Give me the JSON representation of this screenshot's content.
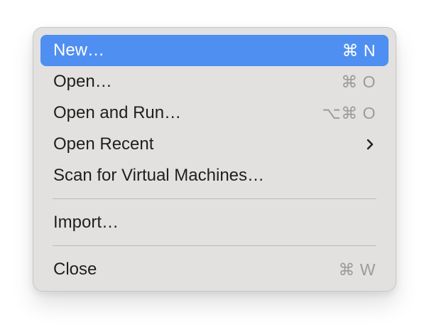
{
  "menu": {
    "items": [
      {
        "label": "New…",
        "shortcut": "⌘ N",
        "active": true
      },
      {
        "label": "Open…",
        "shortcut": "⌘ O",
        "active": false
      },
      {
        "label": "Open and Run…",
        "shortcut": "⌥⌘ O",
        "active": false
      },
      {
        "label": "Open Recent",
        "submenu_icon": "chevron-right-icon",
        "active": false
      },
      {
        "label": "Scan for Virtual Machines…",
        "shortcut": "",
        "active": false
      },
      {
        "label": "Import…",
        "shortcut": "",
        "active": false
      },
      {
        "label": "Close",
        "shortcut": "⌘ W",
        "active": false
      }
    ]
  },
  "colors": {
    "menu_background": "#e2e1df",
    "selection": "#4f8ff1",
    "text": "#1f1f1f",
    "shortcut_text": "#9b9b9b",
    "selected_text": "#ffffff"
  }
}
